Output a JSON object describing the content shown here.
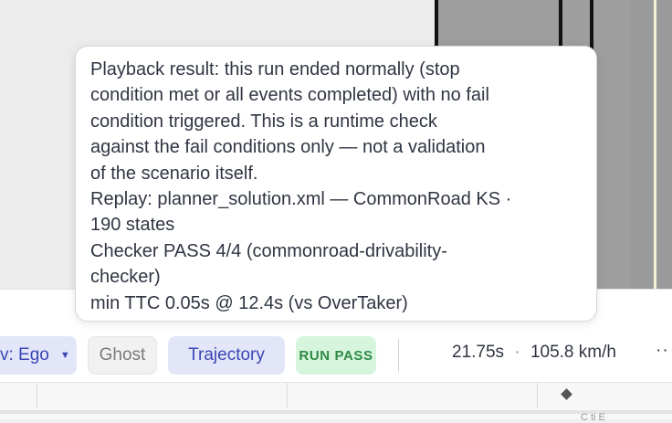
{
  "tooltip": {
    "lines": [
      "Playback result: this run ended normally (stop",
      "condition met or all events completed) with no fail",
      "condition triggered. This is a runtime check",
      "against the fail conditions only — not a validation",
      "of the scenario itself.",
      "Replay: planner_solution.xml — CommonRoad KS ·",
      "190 states",
      "Checker PASS 4/4 (commonroad-drivability-",
      "checker)",
      "min TTC 0.05s @ 12.4s (vs OverTaker)"
    ]
  },
  "toolbar": {
    "view_label": "v: Ego",
    "ghost_label": "Ghost",
    "trajectory_label": "Trajectory",
    "run_status": "RUN PASS",
    "time": "21.75s",
    "separator": "·",
    "speed": "105.8 km/h",
    "more": "··"
  },
  "timeline": {
    "clip_label": "C ti  E"
  },
  "colors": {
    "accent": "#3b46b5",
    "pass_bg": "#d7f5dd",
    "pass_text": "#2e8a46"
  }
}
